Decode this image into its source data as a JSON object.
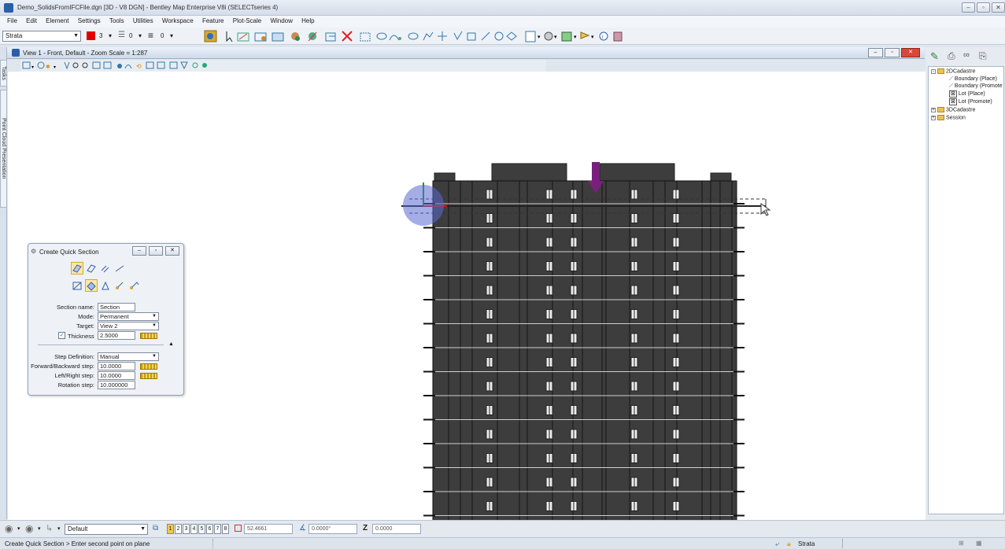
{
  "window": {
    "title": "Demo_SolidsFromIFCFile.dgn [3D - V8 DGN] - Bentley Map Enterprise V8i (SELECTseries 4)"
  },
  "menu": [
    "File",
    "Edit",
    "Element",
    "Settings",
    "Tools",
    "Utilities",
    "Workspace",
    "Feature",
    "Plot-Scale",
    "Window",
    "Help"
  ],
  "toolbar": {
    "level": "Strata",
    "color": "3",
    "weight": "0",
    "style": "0"
  },
  "view": {
    "title": "View 1 - Front, Default - Zoom Scale = 1:287"
  },
  "left_tabs": [
    "Tasks",
    "Point Cloud Presentation"
  ],
  "dialog": {
    "title": "Create Quick Section",
    "section_name_label": "Section name:",
    "section_name": "Section",
    "mode_label": "Mode:",
    "mode": "Permanent",
    "target_label": "Target:",
    "target": "View 2",
    "thickness_label": "Thickness",
    "thickness": "2.5000",
    "thickness_checked": true,
    "step_definition_label": "Step Definition:",
    "step_definition": "Manual",
    "fwd_back_label": "Forward/Backward step:",
    "fwd_back": "10.0000",
    "left_right_label": "Left/Right step:",
    "left_right": "10.0000",
    "rotation_label": "Rotation step:",
    "rotation": "10.000000"
  },
  "tree": {
    "items": [
      {
        "label": "2DCadastre",
        "type": "folder"
      },
      {
        "label": "Boundary (Place)",
        "type": "leaf"
      },
      {
        "label": "Boundary (Promote",
        "type": "leaf"
      },
      {
        "label": "Lot (Place)",
        "type": "leaf"
      },
      {
        "label": "Lot (Promote)",
        "type": "leaf"
      },
      {
        "label": "3DCadastre",
        "type": "folder"
      },
      {
        "label": "Session",
        "type": "folder"
      }
    ]
  },
  "bottom": {
    "view_attributes": "Default",
    "view_buttons": [
      "1",
      "2",
      "3",
      "4",
      "5",
      "6",
      "7",
      "8"
    ],
    "x": "52.4661",
    "angle": "0.0000°",
    "z_label": "Z",
    "z": "0.0000"
  },
  "status": {
    "message": "Create Quick Section > Enter second point on plane",
    "level": "Strata"
  },
  "colors": {
    "building": "#3d3d3d",
    "marker": "#7b1f7e",
    "accent": "#2a5fa8"
  }
}
